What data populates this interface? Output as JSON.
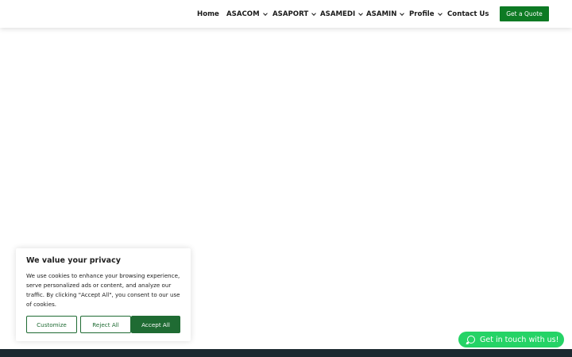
{
  "header": {
    "nav": [
      {
        "label": "Home",
        "has_dropdown": false
      },
      {
        "label": "ASACOM",
        "has_dropdown": true
      },
      {
        "label": "ASAPORT",
        "has_dropdown": true
      },
      {
        "label": "ASAMEDI",
        "has_dropdown": true
      },
      {
        "label": "ASAMIN",
        "has_dropdown": true
      },
      {
        "label": "Profile",
        "has_dropdown": true
      },
      {
        "label": "Contact Us",
        "has_dropdown": false
      }
    ],
    "cta_label": "Get a Quote"
  },
  "cookie_banner": {
    "title": "We value your privacy",
    "text": "We use cookies to enhance your browsing experience, serve personalized ads or content, and analyze our traffic. By clicking \"Accept All\", you consent to our use of cookies.",
    "buttons": {
      "customize": "Customize",
      "reject": "Reject All",
      "accept": "Accept All"
    }
  },
  "whatsapp": {
    "label": "Get in touch with us!",
    "icon": "whatsapp-icon"
  },
  "colors": {
    "brand_green": "#0d7a24",
    "cookie_green": "#1f6b33",
    "whatsapp_green": "#25d366",
    "footer": "#1c2930"
  }
}
